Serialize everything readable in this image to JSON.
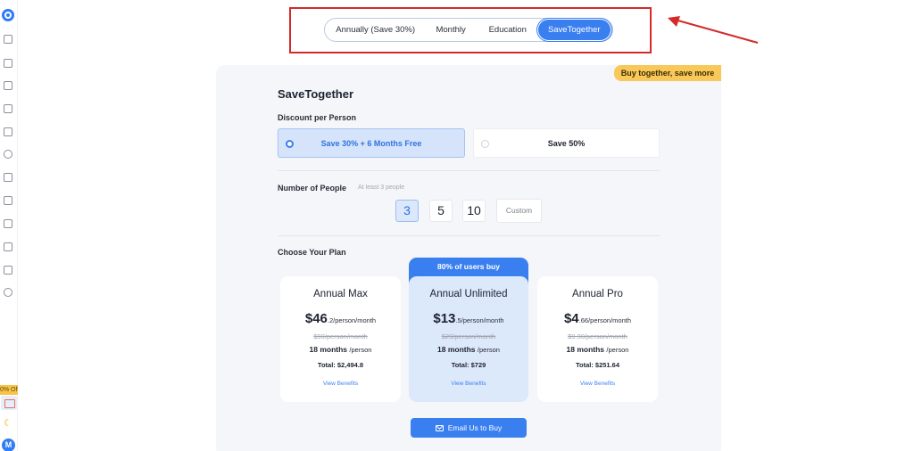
{
  "sidebar": {
    "promo_label": "0% Off",
    "avatar_initial": "M",
    "items": [
      "home-icon",
      "camera-icon",
      "caption-icon",
      "document-icon",
      "code-icon",
      "image-edit-icon",
      "chat-icon",
      "edit-icon",
      "gallery-icon",
      "screen-icon",
      "hourglass-icon",
      "book-icon",
      "circle-icon"
    ]
  },
  "tabs": [
    {
      "label": "Annually (Save 30%)",
      "active": false
    },
    {
      "label": "Monthly",
      "active": false
    },
    {
      "label": "Education",
      "active": false
    },
    {
      "label": "SaveTogether",
      "active": true
    }
  ],
  "ribbon": "Buy together, save more",
  "card": {
    "title": "SaveTogether",
    "discount_label": "Discount per Person",
    "discount_options": [
      {
        "label": "Save 30% + 6 Months Free",
        "selected": true
      },
      {
        "label": "Save 50%",
        "selected": false
      }
    ],
    "people_label": "Number of People",
    "people_hint": "At least 3 people",
    "people_options": [
      "3",
      "5",
      "10"
    ],
    "people_selected": "3",
    "custom_label": "Custom",
    "plan_label": "Choose Your Plan",
    "popular_badge": "80% of users buy",
    "plans": [
      {
        "name": "Annual Max",
        "price_main": "$46",
        "price_rest": ".2/person/month",
        "old_price": "$90/person/month",
        "months": "18 months",
        "months_unit": "/person",
        "total": "Total: $2,494.8",
        "link": "View Benefits"
      },
      {
        "name": "Annual Unlimited",
        "price_main": "$13",
        "price_rest": ".5/person/month",
        "old_price": "$29/person/month",
        "months": "18 months",
        "months_unit": "/person",
        "total": "Total: $729",
        "link": "View Benefits"
      },
      {
        "name": "Annual Pro",
        "price_main": "$4",
        "price_rest": ".66/person/month",
        "old_price": "$9.90/person/month",
        "months": "18 months",
        "months_unit": "/person",
        "total": "Total: $251.64",
        "link": "View Benefits"
      }
    ],
    "buy_button": "Email Us to Buy"
  },
  "colors": {
    "accent": "#3a7ff0",
    "annotation": "#d42a2a",
    "ribbon": "#f8c95a"
  }
}
